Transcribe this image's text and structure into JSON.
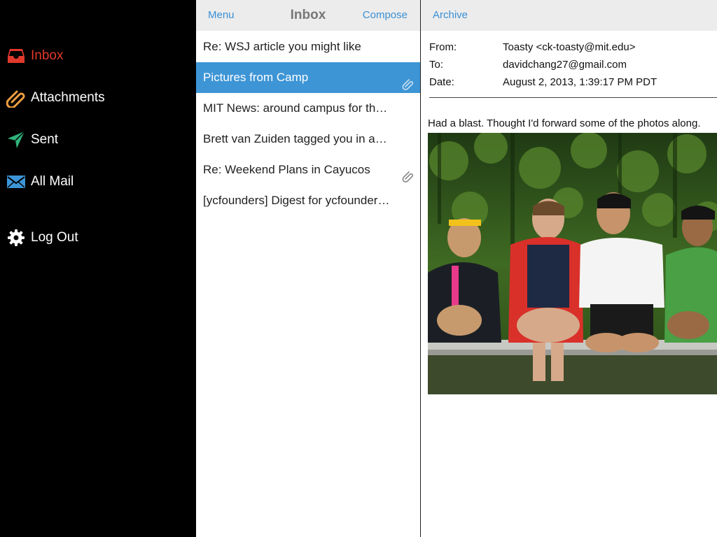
{
  "sidebar": {
    "items": [
      {
        "label": "Inbox",
        "icon": "inbox-icon",
        "active": true,
        "color": "#e0392c"
      },
      {
        "label": "Attachments",
        "icon": "paperclip-icon",
        "color": "#f0a040"
      },
      {
        "label": "Sent",
        "icon": "send-icon",
        "color": "#2fb37a"
      },
      {
        "label": "All Mail",
        "icon": "envelope-icon",
        "color": "#3d95d6"
      },
      {
        "label": "Log Out",
        "icon": "gear-icon",
        "color": "#ffffff"
      }
    ]
  },
  "list_header": {
    "menu_label": "Menu",
    "title": "Inbox",
    "compose_label": "Compose"
  },
  "messages": [
    {
      "subject": "Re: WSJ article you might like",
      "attachment": false,
      "selected": false
    },
    {
      "subject": "Pictures from Camp",
      "attachment": true,
      "selected": true
    },
    {
      "subject": "MIT News: around campus for th…",
      "attachment": false,
      "selected": false
    },
    {
      "subject": "Brett van Zuiden tagged you in a…",
      "attachment": false,
      "selected": false
    },
    {
      "subject": "Re: Weekend Plans in Cayucos",
      "attachment": true,
      "selected": false
    },
    {
      "subject": "[ycfounders] Digest for ycfounder…",
      "attachment": false,
      "selected": false
    }
  ],
  "message_view": {
    "archive_label": "Archive",
    "from_label": "From:",
    "from_value": "Toasty <ck-toasty@mit.edu>",
    "to_label": "To:",
    "to_value": "davidchang27@gmail.com",
    "date_label": "Date:",
    "date_value": "August 2, 2013, 1:39:17 PM PDT",
    "body": "Had a blast. Thought I'd forward some of the photos along."
  },
  "colors": {
    "accent_blue": "#3d95d6",
    "link_blue": "#3a8fd4",
    "inbox_red": "#e0392c"
  }
}
